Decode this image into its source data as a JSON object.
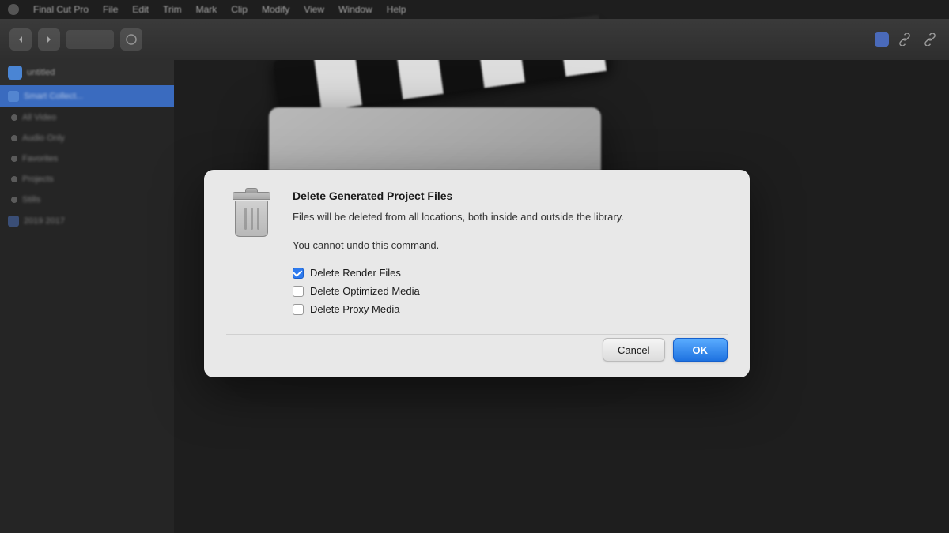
{
  "app": {
    "name": "Final Cut Pro",
    "menubar": {
      "items": [
        "Final Cut Pro",
        "File",
        "Edit",
        "Trim",
        "Mark",
        "Clip",
        "Modify",
        "View",
        "Window",
        "Help"
      ]
    }
  },
  "sidebar": {
    "header_label": "untitled",
    "active_item": "Smart Collect...",
    "items": [
      {
        "label": "All Video"
      },
      {
        "label": "Audio Only"
      },
      {
        "label": "Favorites"
      },
      {
        "label": "Projects"
      },
      {
        "label": "Stills"
      },
      {
        "label": "2019 2017"
      }
    ]
  },
  "dialog": {
    "title": "Delete Generated Project Files",
    "description": "Files will be deleted from all locations, both inside and outside the library.",
    "warning": "You cannot undo this command.",
    "checkboxes": [
      {
        "id": "render",
        "label": "Delete Render Files",
        "checked": true
      },
      {
        "id": "optimized",
        "label": "Delete Optimized Media",
        "checked": false
      },
      {
        "id": "proxy",
        "label": "Delete Proxy Media",
        "checked": false
      }
    ],
    "buttons": {
      "cancel": "Cancel",
      "ok": "OK"
    }
  }
}
